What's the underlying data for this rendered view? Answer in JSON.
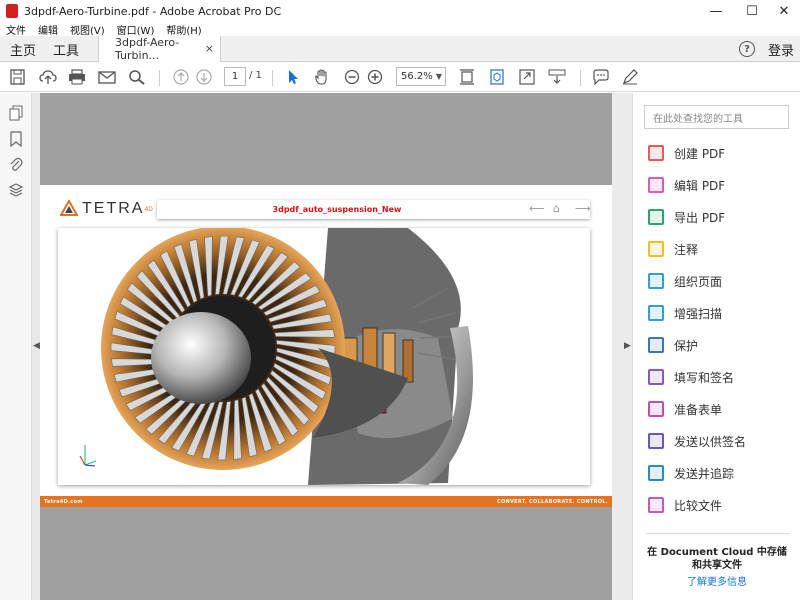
{
  "window": {
    "title": "3dpdf-Aero-Turbine.pdf - Adobe Acrobat Pro DC",
    "min": "—",
    "max": "☐",
    "close": "✕"
  },
  "menu": [
    "文件",
    "编辑",
    "视图(V)",
    "窗口(W)",
    "帮助(H)"
  ],
  "tabs": {
    "home": "主页",
    "tools": "工具",
    "doc": "3dpdf-Aero-Turbin...",
    "close": "×",
    "help": "?",
    "login": "登录"
  },
  "toolbar": {
    "page_current": "1",
    "page_total": "/ 1",
    "zoom": "56.2%"
  },
  "document": {
    "logo": "TETRA",
    "logo_sup": "4D",
    "banner_title": "3dpdf_auto_suspension_New",
    "footer_left": "Tetra4D.com",
    "footer_right": "CONVERT. COLLABORATE. CONTROL."
  },
  "right_panel": {
    "search_placeholder": "在此处查找您的工具",
    "tools": [
      {
        "label": "创建 PDF",
        "icon": "create-pdf-icon",
        "color": "#e35b5b"
      },
      {
        "label": "编辑 PDF",
        "icon": "edit-pdf-icon",
        "color": "#d85bb5"
      },
      {
        "label": "导出 PDF",
        "icon": "export-pdf-icon",
        "color": "#2ea36b"
      },
      {
        "label": "注释",
        "icon": "comment-icon",
        "color": "#f3c01b"
      },
      {
        "label": "组织页面",
        "icon": "organize-pages-icon",
        "color": "#2f9fd8"
      },
      {
        "label": "增强扫描",
        "icon": "enhance-scan-icon",
        "color": "#2f9fd8"
      },
      {
        "label": "保护",
        "icon": "protect-icon",
        "color": "#3a73c8"
      },
      {
        "label": "填写和签名",
        "icon": "fill-sign-icon",
        "color": "#8a57c5"
      },
      {
        "label": "准备表单",
        "icon": "prepare-form-icon",
        "color": "#c04faa"
      },
      {
        "label": "发送以供签名",
        "icon": "send-for-signature-icon",
        "color": "#6a55c8"
      },
      {
        "label": "发送并追踪",
        "icon": "send-track-icon",
        "color": "#2a8ad0"
      },
      {
        "label": "比较文件",
        "icon": "compare-files-icon",
        "color": "#c45bb0"
      }
    ],
    "cloud_title": "在 Document Cloud 中存储和共享文件",
    "cloud_link": "了解更多信息"
  }
}
